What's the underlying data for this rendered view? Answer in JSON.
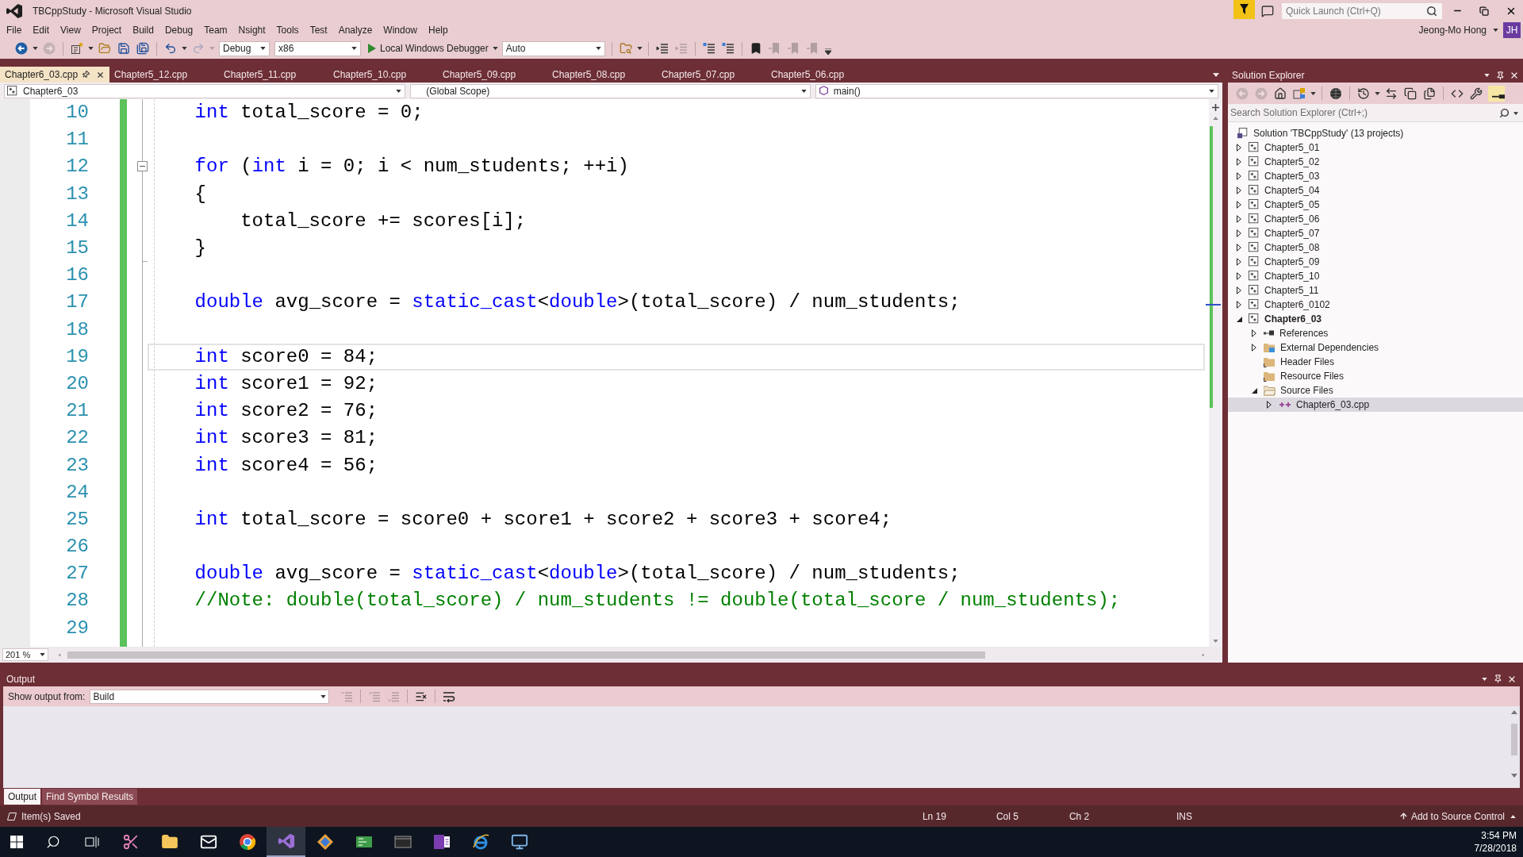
{
  "window": {
    "title": "TBCppStudy - Microsoft Visual Studio",
    "quick_launch": {
      "placeholder": "Quick Launch (Ctrl+Q)"
    }
  },
  "menu": [
    "File",
    "Edit",
    "View",
    "Project",
    "Build",
    "Debug",
    "Team",
    "Nsight",
    "Tools",
    "Test",
    "Analyze",
    "Window",
    "Help"
  ],
  "account": {
    "name": "Jeong-Mo Hong",
    "initials": "JH"
  },
  "toolbar": [
    {
      "kind": "back",
      "disabled": false
    },
    {
      "kind": "caret",
      "disabled": false
    },
    {
      "kind": "forward",
      "disabled": true
    },
    {
      "kind": "separator"
    },
    {
      "kind": "new_project",
      "disabled": false
    },
    {
      "kind": "caret",
      "disabled": false
    },
    {
      "kind": "open",
      "disabled": false
    },
    {
      "kind": "save",
      "disabled": false
    },
    {
      "kind": "save_all",
      "disabled": false
    },
    {
      "kind": "separator"
    },
    {
      "kind": "undo",
      "disabled": false
    },
    {
      "kind": "caret",
      "disabled": false
    },
    {
      "kind": "redo",
      "disabled": true
    },
    {
      "kind": "caret",
      "disabled": true
    },
    {
      "kind": "dropdown",
      "value": "Debug"
    },
    {
      "kind": "dropdown",
      "value": "x86"
    },
    {
      "kind": "run",
      "label": "Local Windows Debugger"
    },
    {
      "kind": "caret",
      "disabled": false
    },
    {
      "kind": "dropdown",
      "value": "Auto"
    },
    {
      "kind": "separator"
    },
    {
      "kind": "find_in_files",
      "disabled": false
    },
    {
      "kind": "caret",
      "disabled": false
    },
    {
      "kind": "separator"
    },
    {
      "kind": "outdent",
      "disabled": false
    },
    {
      "kind": "indent",
      "disabled": true
    },
    {
      "kind": "separator"
    },
    {
      "kind": "comment",
      "disabled": false
    },
    {
      "kind": "uncomment",
      "disabled": false
    },
    {
      "kind": "separator"
    },
    {
      "kind": "bookmark",
      "disabled": false
    },
    {
      "kind": "bookmark_prev",
      "disabled": true
    },
    {
      "kind": "bookmark_next",
      "disabled": true
    },
    {
      "kind": "bookmark_clear",
      "disabled": true
    },
    {
      "kind": "overflow",
      "disabled": false
    }
  ],
  "tabs": [
    {
      "label": "Chapter6_03.cpp",
      "selected": true
    },
    {
      "label": "Chapter5_12.cpp",
      "selected": false
    },
    {
      "label": "Chapter5_11.cpp",
      "selected": false
    },
    {
      "label": "Chapter5_10.cpp",
      "selected": false
    },
    {
      "label": "Chapter5_09.cpp",
      "selected": false
    },
    {
      "label": "Chapter5_08.cpp",
      "selected": false
    },
    {
      "label": "Chapter5_07.cpp",
      "selected": false
    },
    {
      "label": "Chapter5_06.cpp",
      "selected": false
    }
  ],
  "navigation": [
    {
      "kind": "project",
      "value": "Chapter6_03"
    },
    {
      "kind": "scope",
      "value": "(Global Scope)"
    },
    {
      "kind": "function",
      "value": "main()"
    }
  ],
  "editor": {
    "changes_saved": true,
    "zoom": "201 %",
    "lines": [
      {
        "number": "10",
        "selected": false,
        "tokens": [
          {
            "kind": "keyword",
            "text": "int"
          },
          {
            "kind": "plain",
            "text": " total_score = 0;"
          }
        ]
      },
      {
        "number": "11",
        "selected": false
      },
      {
        "number": "12",
        "selected": false,
        "expanded": true,
        "tokens": [
          {
            "kind": "keyword",
            "text": "for"
          },
          {
            "kind": "plain",
            "text": " ("
          },
          {
            "kind": "keyword",
            "text": "int"
          },
          {
            "kind": "plain",
            "text": " i = 0; i < num_students; ++i)"
          }
        ]
      },
      {
        "number": "13",
        "selected": false,
        "tokens": [
          {
            "kind": "plain",
            "text": "{"
          }
        ],
        "children": [
          {
            "number": "14",
            "selected": false,
            "tokens": [
              {
                "kind": "plain",
                "text": "total_score += scores[i];"
              }
            ]
          }
        ]
      },
      {
        "number": "15",
        "selected": false,
        "block_end": true,
        "tokens": [
          {
            "kind": "plain",
            "text": "}"
          }
        ]
      },
      {
        "number": "16",
        "selected": false
      },
      {
        "number": "17",
        "selected": false,
        "tokens": [
          {
            "kind": "keyword",
            "text": "double"
          },
          {
            "kind": "plain",
            "text": " avg_score = "
          },
          {
            "kind": "keyword",
            "text": "static_cast"
          },
          {
            "kind": "plain",
            "text": "<"
          },
          {
            "kind": "keyword",
            "text": "double"
          },
          {
            "kind": "plain",
            "text": ">(total_score) / num_students;"
          }
        ]
      },
      {
        "number": "18",
        "selected": false
      },
      {
        "number": "19",
        "selected": true,
        "tokens": [
          {
            "kind": "keyword",
            "text": "int"
          },
          {
            "kind": "plain",
            "text": " score0 = 84;"
          }
        ]
      },
      {
        "number": "20",
        "selected": false,
        "tokens": [
          {
            "kind": "keyword",
            "text": "int"
          },
          {
            "kind": "plain",
            "text": " score1 = 92;"
          }
        ]
      },
      {
        "number": "21",
        "selected": false,
        "tokens": [
          {
            "kind": "keyword",
            "text": "int"
          },
          {
            "kind": "plain",
            "text": " score2 = 76;"
          }
        ]
      },
      {
        "number": "22",
        "selected": false,
        "tokens": [
          {
            "kind": "keyword",
            "text": "int"
          },
          {
            "kind": "plain",
            "text": " score3 = 81;"
          }
        ]
      },
      {
        "number": "23",
        "selected": false,
        "tokens": [
          {
            "kind": "keyword",
            "text": "int"
          },
          {
            "kind": "plain",
            "text": " score4 = 56;"
          }
        ]
      },
      {
        "number": "24",
        "selected": false
      },
      {
        "number": "25",
        "selected": false,
        "tokens": [
          {
            "kind": "keyword",
            "text": "int"
          },
          {
            "kind": "plain",
            "text": " total_score = score0 + score1 + score2 + score3 + score4;"
          }
        ]
      },
      {
        "number": "26",
        "selected": false
      },
      {
        "number": "27",
        "selected": false,
        "tokens": [
          {
            "kind": "keyword",
            "text": "double"
          },
          {
            "kind": "plain",
            "text": " avg_score = "
          },
          {
            "kind": "keyword",
            "text": "static_cast"
          },
          {
            "kind": "plain",
            "text": "<"
          },
          {
            "kind": "keyword",
            "text": "double"
          },
          {
            "kind": "plain",
            "text": ">(total_score) / num_students;"
          }
        ]
      },
      {
        "number": "28",
        "selected": false,
        "tokens": [
          {
            "kind": "comment",
            "text": "//Note: double(total_score) / num_students != double(total_score / num_students);"
          }
        ]
      },
      {
        "number": "29",
        "selected": false
      }
    ]
  },
  "solution_explorer": {
    "title": "Solution Explorer",
    "toolbar": [
      {
        "kind": "back",
        "disabled": true
      },
      {
        "kind": "forward",
        "disabled": true
      },
      {
        "kind": "home",
        "disabled": false
      },
      {
        "kind": "switch_views",
        "disabled": false
      },
      {
        "kind": "caret",
        "disabled": false
      },
      {
        "kind": "separator"
      },
      {
        "kind": "pending",
        "disabled": false
      },
      {
        "kind": "separator"
      },
      {
        "kind": "history",
        "disabled": false
      },
      {
        "kind": "caret",
        "disabled": false
      },
      {
        "kind": "sync",
        "disabled": false
      },
      {
        "kind": "collapse_all",
        "disabled": false
      },
      {
        "kind": "show_all",
        "disabled": false
      },
      {
        "kind": "separator"
      },
      {
        "kind": "view_code",
        "disabled": false
      },
      {
        "kind": "properties",
        "disabled": false
      },
      {
        "kind": "preview",
        "on": true
      }
    ],
    "search": {
      "placeholder": "Search Solution Explorer (Ctrl+;)"
    },
    "tree": {
      "kind": "solution",
      "label": "Solution 'TBCppStudy' (13 projects)",
      "selected": false,
      "children": [
        {
          "kind": "project",
          "label": "Chapter5_01",
          "expanded": false,
          "startup": false,
          "selected": false
        },
        {
          "kind": "project",
          "label": "Chapter5_02",
          "expanded": false,
          "startup": false,
          "selected": false
        },
        {
          "kind": "project",
          "label": "Chapter5_03",
          "expanded": false,
          "startup": false,
          "selected": false
        },
        {
          "kind": "project",
          "label": "Chapter5_04",
          "expanded": false,
          "startup": false,
          "selected": false
        },
        {
          "kind": "project",
          "label": "Chapter5_05",
          "expanded": false,
          "startup": false,
          "selected": false
        },
        {
          "kind": "project",
          "label": "Chapter5_06",
          "expanded": false,
          "startup": false,
          "selected": false
        },
        {
          "kind": "project",
          "label": "Chapter5_07",
          "expanded": false,
          "startup": false,
          "selected": false
        },
        {
          "kind": "project",
          "label": "Chapter5_08",
          "expanded": false,
          "startup": false,
          "selected": false
        },
        {
          "kind": "project",
          "label": "Chapter5_09",
          "expanded": false,
          "startup": false,
          "selected": false
        },
        {
          "kind": "project",
          "label": "Chapter5_10",
          "expanded": false,
          "startup": false,
          "selected": false
        },
        {
          "kind": "project",
          "label": "Chapter5_11",
          "expanded": false,
          "startup": false,
          "selected": false
        },
        {
          "kind": "project",
          "label": "Chapter6_0102",
          "expanded": false,
          "startup": false,
          "selected": false
        },
        {
          "kind": "project",
          "label": "Chapter6_03",
          "expanded": true,
          "startup": true,
          "selected": false,
          "children": [
            {
              "kind": "references",
              "label": "References",
              "expanded": false,
              "selected": false
            },
            {
              "kind": "external",
              "label": "External Dependencies",
              "expanded": false,
              "selected": false
            },
            {
              "kind": "filter",
              "label": "Header Files",
              "selected": false
            },
            {
              "kind": "filter",
              "label": "Resource Files",
              "selected": false
            },
            {
              "kind": "filter",
              "label": "Source Files",
              "expanded": true,
              "selected": false,
              "children": [
                {
                  "kind": "file",
                  "label": "Chapter6_03.cpp",
                  "expanded": false,
                  "selected": true
                }
              ]
            }
          ]
        }
      ]
    }
  },
  "output": {
    "title": "Output",
    "source_label": "Show output from:",
    "source": "Build",
    "toolbar": [
      {
        "kind": "goto",
        "disabled": true
      },
      {
        "kind": "separator"
      },
      {
        "kind": "prev",
        "disabled": true
      },
      {
        "kind": "next",
        "disabled": true
      },
      {
        "kind": "separator"
      },
      {
        "kind": "clear",
        "disabled": false
      },
      {
        "kind": "separator"
      },
      {
        "kind": "wrap",
        "disabled": false
      }
    ],
    "tabs": [
      {
        "label": "Output",
        "selected": true
      },
      {
        "label": "Find Symbol Results",
        "selected": false
      }
    ]
  },
  "status_bar": {
    "message": "Item(s) Saved",
    "line": "Ln 19",
    "column": "Col 5",
    "char": "Ch 2",
    "mode": "INS",
    "source_control": "Add to Source Control"
  },
  "taskbar": {
    "items": [
      {
        "kind": "start",
        "selected": false
      },
      {
        "kind": "search",
        "selected": false
      },
      {
        "kind": "task_view",
        "selected": false
      },
      {
        "kind": "scissors",
        "selected": false
      },
      {
        "kind": "folder",
        "selected": false
      },
      {
        "kind": "mail",
        "selected": false
      },
      {
        "kind": "browser",
        "selected": false
      },
      {
        "kind": "ribbon",
        "selected": true
      },
      {
        "kind": "diamond",
        "selected": false
      },
      {
        "kind": "board",
        "selected": false
      },
      {
        "kind": "terminal",
        "selected": false
      },
      {
        "kind": "notebook",
        "selected": false
      },
      {
        "kind": "swoosh",
        "selected": false
      },
      {
        "kind": "monitor",
        "selected": false
      }
    ],
    "time": "3:54 PM",
    "date": "7/28/2018"
  }
}
